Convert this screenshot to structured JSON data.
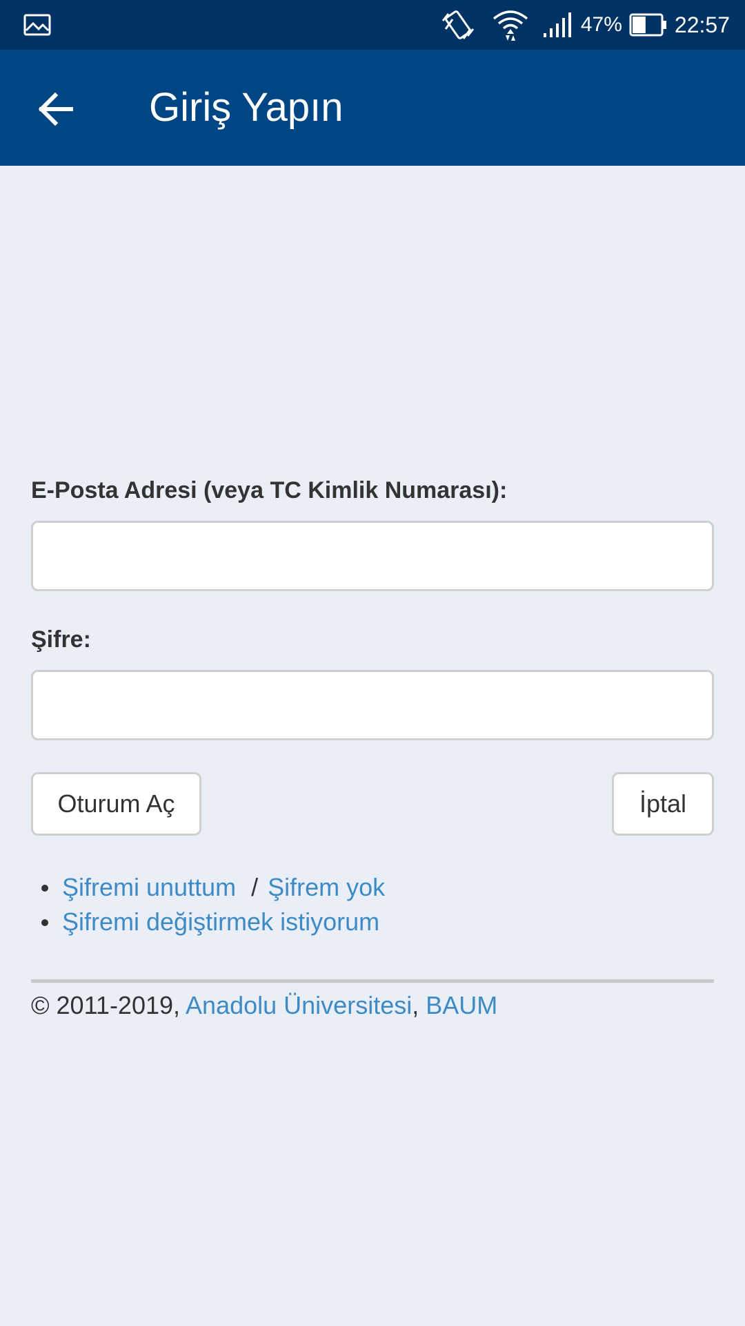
{
  "status_bar": {
    "battery_percent": "47%",
    "time": "22:57",
    "icons": [
      "gallery-icon",
      "vibrate-icon",
      "wifi-icon",
      "signal-icon",
      "battery-icon"
    ],
    "battery_level": 0.47
  },
  "app_bar": {
    "title": "Giriş Yapın",
    "back_icon": "arrow-left-icon"
  },
  "form": {
    "email_label": "E-Posta Adresi (veya TC Kimlik Numarası):",
    "email_value": "",
    "password_label": "Şifre:",
    "password_value": "",
    "login_button": "Oturum Aç",
    "cancel_button": "İptal"
  },
  "links": {
    "forgot_password": "Şifremi unuttum",
    "separator": "/",
    "no_password": "Şifrem yok",
    "change_password": "Şifremi değiştirmek istiyorum"
  },
  "footer": {
    "copyright": "© 2011-2019,",
    "university": "Anadolu Üniversitesi",
    "comma": ",",
    "baum": "BAUM"
  },
  "colors": {
    "status_bar": "#013264",
    "app_bar": "#004584",
    "background": "#e9eef7",
    "link": "#3d8ac4",
    "text": "#333333"
  }
}
